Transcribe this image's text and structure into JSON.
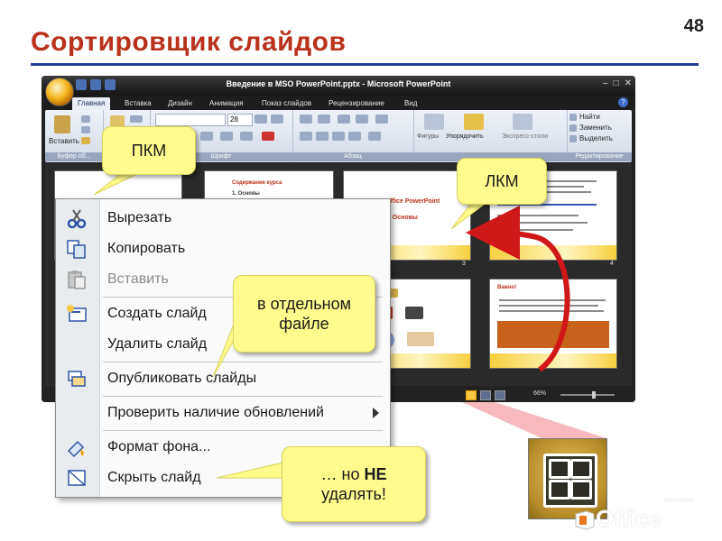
{
  "slide": {
    "number": "48",
    "title": "Сортировщик слайдов"
  },
  "window": {
    "title": "Введение в  MSO PowerPoint.pptx - Microsoft PowerPoint"
  },
  "ribbon": {
    "tabs": [
      "Главная",
      "Вставка",
      "Дизайн",
      "Анимация",
      "Показ слайдов",
      "Рецензирование",
      "Вид"
    ],
    "active_tab": "Главная",
    "groups": {
      "clipboard": {
        "label": "Буфер об...",
        "paste": "Вставить"
      },
      "font": {
        "label": "Шрифт",
        "size": "28"
      },
      "paragraph": {
        "label": "Абзац"
      },
      "drawing": {
        "shapes": "Фигуры",
        "arrange": "Упорядочить",
        "quick_styles": "Экспресс-стили"
      },
      "editing": {
        "label": "Редактирование",
        "find": "Найти",
        "replace": "Заменить",
        "select": "Выделить"
      }
    }
  },
  "thumbnails": [
    {
      "slide_heading": "Содержание курса",
      "item": "1. Основы"
    },
    {
      "slide_heading": "Office PowerPoint",
      "item": "1. Основы"
    },
    {
      "slide_heading": "Важно!"
    }
  ],
  "thumbnail_numbers": [
    "3",
    "4"
  ],
  "status": {
    "zoom": "66%"
  },
  "context_menu": {
    "items": [
      {
        "label": "Вырезать",
        "icon": "scissors-icon",
        "disabled": false
      },
      {
        "label": "Копировать",
        "icon": "copy-icon",
        "disabled": false
      },
      {
        "label": "Вставить",
        "icon": "paste-icon",
        "disabled": true
      },
      {
        "label": "Создать слайд",
        "icon": "new-slide-icon",
        "disabled": false
      },
      {
        "label": "Удалить слайд",
        "icon": "none",
        "disabled": false
      },
      {
        "label": "Опубликовать слайды",
        "icon": "publish-slides-icon",
        "disabled": false
      },
      {
        "label": "Проверить наличие обновлений",
        "icon": "none",
        "disabled": false,
        "submenu": true
      },
      {
        "label": "Формат фона...",
        "icon": "format-background-icon",
        "disabled": false
      },
      {
        "label": "Скрыть слайд",
        "icon": "hide-slide-icon",
        "disabled": false
      }
    ]
  },
  "callouts": {
    "pkm": "ПКМ",
    "lkm": "ЛКМ",
    "separate_file": "в отдельном файле",
    "dont_delete_prefix": "… но",
    "dont_delete_strong": "НЕ",
    "dont_delete_suffix": "удалять!"
  },
  "branding": {
    "office": "Office",
    "microsoft": "Microsoft®"
  },
  "colors": {
    "title": "#b8321c",
    "rule": "#243c9c",
    "callout": "#fffb8c",
    "beam": "#f4a0a8",
    "arrow": "#d01818"
  }
}
